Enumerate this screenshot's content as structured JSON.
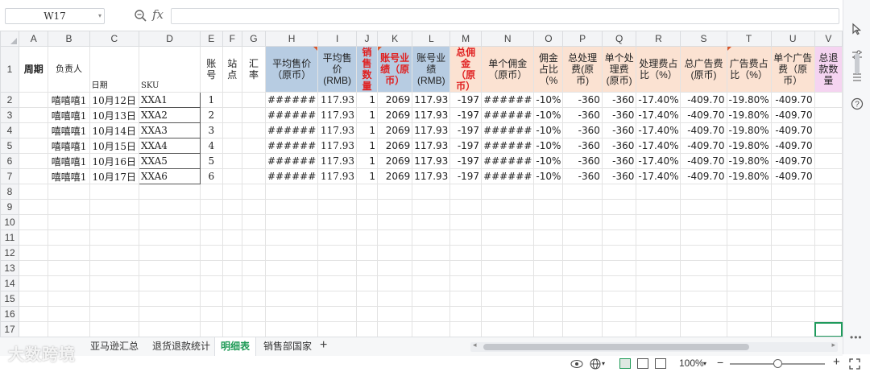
{
  "formula_bar": {
    "name_box": "W17",
    "fx_label": "fx",
    "formula_value": ""
  },
  "column_headers": [
    "A",
    "B",
    "C",
    "D",
    "E",
    "F",
    "G",
    "H",
    "I",
    "J",
    "K",
    "L",
    "M",
    "N",
    "O",
    "P",
    "Q",
    "R",
    "S",
    "T",
    "U",
    "V"
  ],
  "header_row": {
    "row_number": "1",
    "A": "周期",
    "B": "负责人",
    "C": "日期",
    "D": "SKU",
    "E": "账号",
    "F": "站点",
    "G": "汇率",
    "H": "平均售价（原币）",
    "I": "平均售价(RMB)",
    "J": "销售数量",
    "K": "账号业绩（原币）",
    "L": "账号业绩(RMB)",
    "M": "总佣金（原币）",
    "N": "单个佣金（原币）",
    "O": "佣金占比（%",
    "P": "总处理费(原币)",
    "Q": "单个处理费(原币)",
    "R": "处理费占比（%）",
    "S": "总广告费(原币)",
    "T": "广告费占比（%）",
    "U": "单个广告费（原币）",
    "V": "总退款数量"
  },
  "data_rows": [
    {
      "row": "2",
      "A": "",
      "B": "嘻嘻嘻1",
      "C": "10月12日",
      "D": "XXA1",
      "E": "1",
      "F": "",
      "G": "",
      "H": "######",
      "I": "117.93",
      "J": "1",
      "K": "2069",
      "L": "117.93",
      "M": "-197",
      "N": "######",
      "O": "-10%",
      "P": "-360",
      "Q": "-360",
      "R": "-17.40%",
      "S": "-409.70",
      "T": "-19.80%",
      "U": "-409.70"
    },
    {
      "row": "3",
      "A": "",
      "B": "嘻嘻嘻1",
      "C": "10月13日",
      "D": "XXA2",
      "E": "2",
      "F": "",
      "G": "",
      "H": "######",
      "I": "117.93",
      "J": "1",
      "K": "2069",
      "L": "117.93",
      "M": "-197",
      "N": "######",
      "O": "-10%",
      "P": "-360",
      "Q": "-360",
      "R": "-17.40%",
      "S": "-409.70",
      "T": "-19.80%",
      "U": "-409.70"
    },
    {
      "row": "4",
      "A": "",
      "B": "嘻嘻嘻1",
      "C": "10月14日",
      "D": "XXA3",
      "E": "3",
      "F": "",
      "G": "",
      "H": "######",
      "I": "117.93",
      "J": "1",
      "K": "2069",
      "L": "117.93",
      "M": "-197",
      "N": "######",
      "O": "-10%",
      "P": "-360",
      "Q": "-360",
      "R": "-17.40%",
      "S": "-409.70",
      "T": "-19.80%",
      "U": "-409.70"
    },
    {
      "row": "5",
      "A": "",
      "B": "嘻嘻嘻1",
      "C": "10月15日",
      "D": "XXA4",
      "E": "4",
      "F": "",
      "G": "",
      "H": "######",
      "I": "117.93",
      "J": "1",
      "K": "2069",
      "L": "117.93",
      "M": "-197",
      "N": "######",
      "O": "-10%",
      "P": "-360",
      "Q": "-360",
      "R": "-17.40%",
      "S": "-409.70",
      "T": "-19.80%",
      "U": "-409.70"
    },
    {
      "row": "6",
      "A": "",
      "B": "嘻嘻嘻1",
      "C": "10月16日",
      "D": "XXA5",
      "E": "5",
      "F": "",
      "G": "",
      "H": "######",
      "I": "117.93",
      "J": "1",
      "K": "2069",
      "L": "117.93",
      "M": "-197",
      "N": "######",
      "O": "-10%",
      "P": "-360",
      "Q": "-360",
      "R": "-17.40%",
      "S": "-409.70",
      "T": "-19.80%",
      "U": "-409.70"
    },
    {
      "row": "7",
      "A": "",
      "B": "嘻嘻嘻1",
      "C": "10月17日",
      "D": "XXA6",
      "E": "6",
      "F": "",
      "G": "",
      "H": "######",
      "I": "117.93",
      "J": "1",
      "K": "2069",
      "L": "117.93",
      "M": "-197",
      "N": "######",
      "O": "-10%",
      "P": "-360",
      "Q": "-360",
      "R": "-17.40%",
      "S": "-409.70",
      "T": "-19.80%",
      "U": "-409.70"
    }
  ],
  "empty_rows": [
    "8",
    "9",
    "10",
    "11",
    "12",
    "13",
    "14",
    "15",
    "16",
    "17"
  ],
  "sheet_tabs": [
    {
      "label": "亚马逊汇总",
      "active": false
    },
    {
      "label": "退货退款统计",
      "active": false
    },
    {
      "label": "明细表",
      "active": true
    },
    {
      "label": "销售部国家",
      "active": false
    }
  ],
  "add_sheet_label": "+",
  "status_bar": {
    "zoom": "100%",
    "zoom_minus": "−",
    "zoom_plus": "+"
  },
  "watermark": "大数跨境",
  "colors": {
    "accent_green": "#1e9a56",
    "header_blue": "#b7cce2",
    "header_peach": "#fbe2d2",
    "header_pink": "#f5d4f1",
    "red_text": "#e02020"
  },
  "icons": [
    "zoom-icon",
    "function-icon",
    "cursor-icon",
    "adjust-icon",
    "slider-icon",
    "help-icon",
    "eye-icon",
    "globe-icon",
    "normal-view-icon",
    "page-layout-icon",
    "page-break-icon",
    "fullscreen-icon"
  ]
}
